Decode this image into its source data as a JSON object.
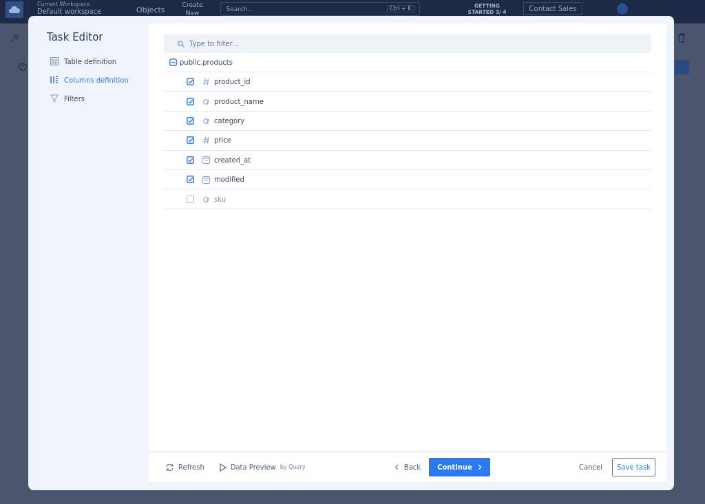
{
  "topbar": {
    "workspace_caption": "Current Workspace",
    "workspace": "Default workspace",
    "objects": "Objects",
    "create": "Create New",
    "search": {
      "placeholder": "Search..."
    },
    "shortcut": "Ctrl + K",
    "getting_started": "GETTING STARTED 3/ 4",
    "contact": "Contact Sales"
  },
  "modal": {
    "title": "Task Editor",
    "steps": [
      {
        "label": "Table definition",
        "kind": "table",
        "selected": false
      },
      {
        "label": "Columns definition",
        "kind": "columns",
        "selected": true
      },
      {
        "label": "Filters",
        "kind": "filter",
        "selected": false
      }
    ],
    "filter": {
      "placeholder": "Type to filter..."
    },
    "tree": {
      "label": "public.products",
      "expanded": true,
      "children": [
        {
          "label": "product_id",
          "kind": "number",
          "checked": true
        },
        {
          "label": "product_name",
          "kind": "text",
          "checked": true
        },
        {
          "label": "category",
          "kind": "text",
          "checked": true
        },
        {
          "label": "price",
          "kind": "number",
          "checked": true
        },
        {
          "label": "created_at",
          "kind": "date",
          "checked": true
        },
        {
          "label": "modified",
          "kind": "date",
          "checked": true
        },
        {
          "label": "sku",
          "kind": "text",
          "checked": false
        }
      ]
    },
    "footer": {
      "refresh": "Refresh",
      "preview": "Data Preview",
      "preview_note": "by Query",
      "back": "Back",
      "continue": "Continue",
      "cancel": "Cancel",
      "save": "Save task"
    }
  }
}
